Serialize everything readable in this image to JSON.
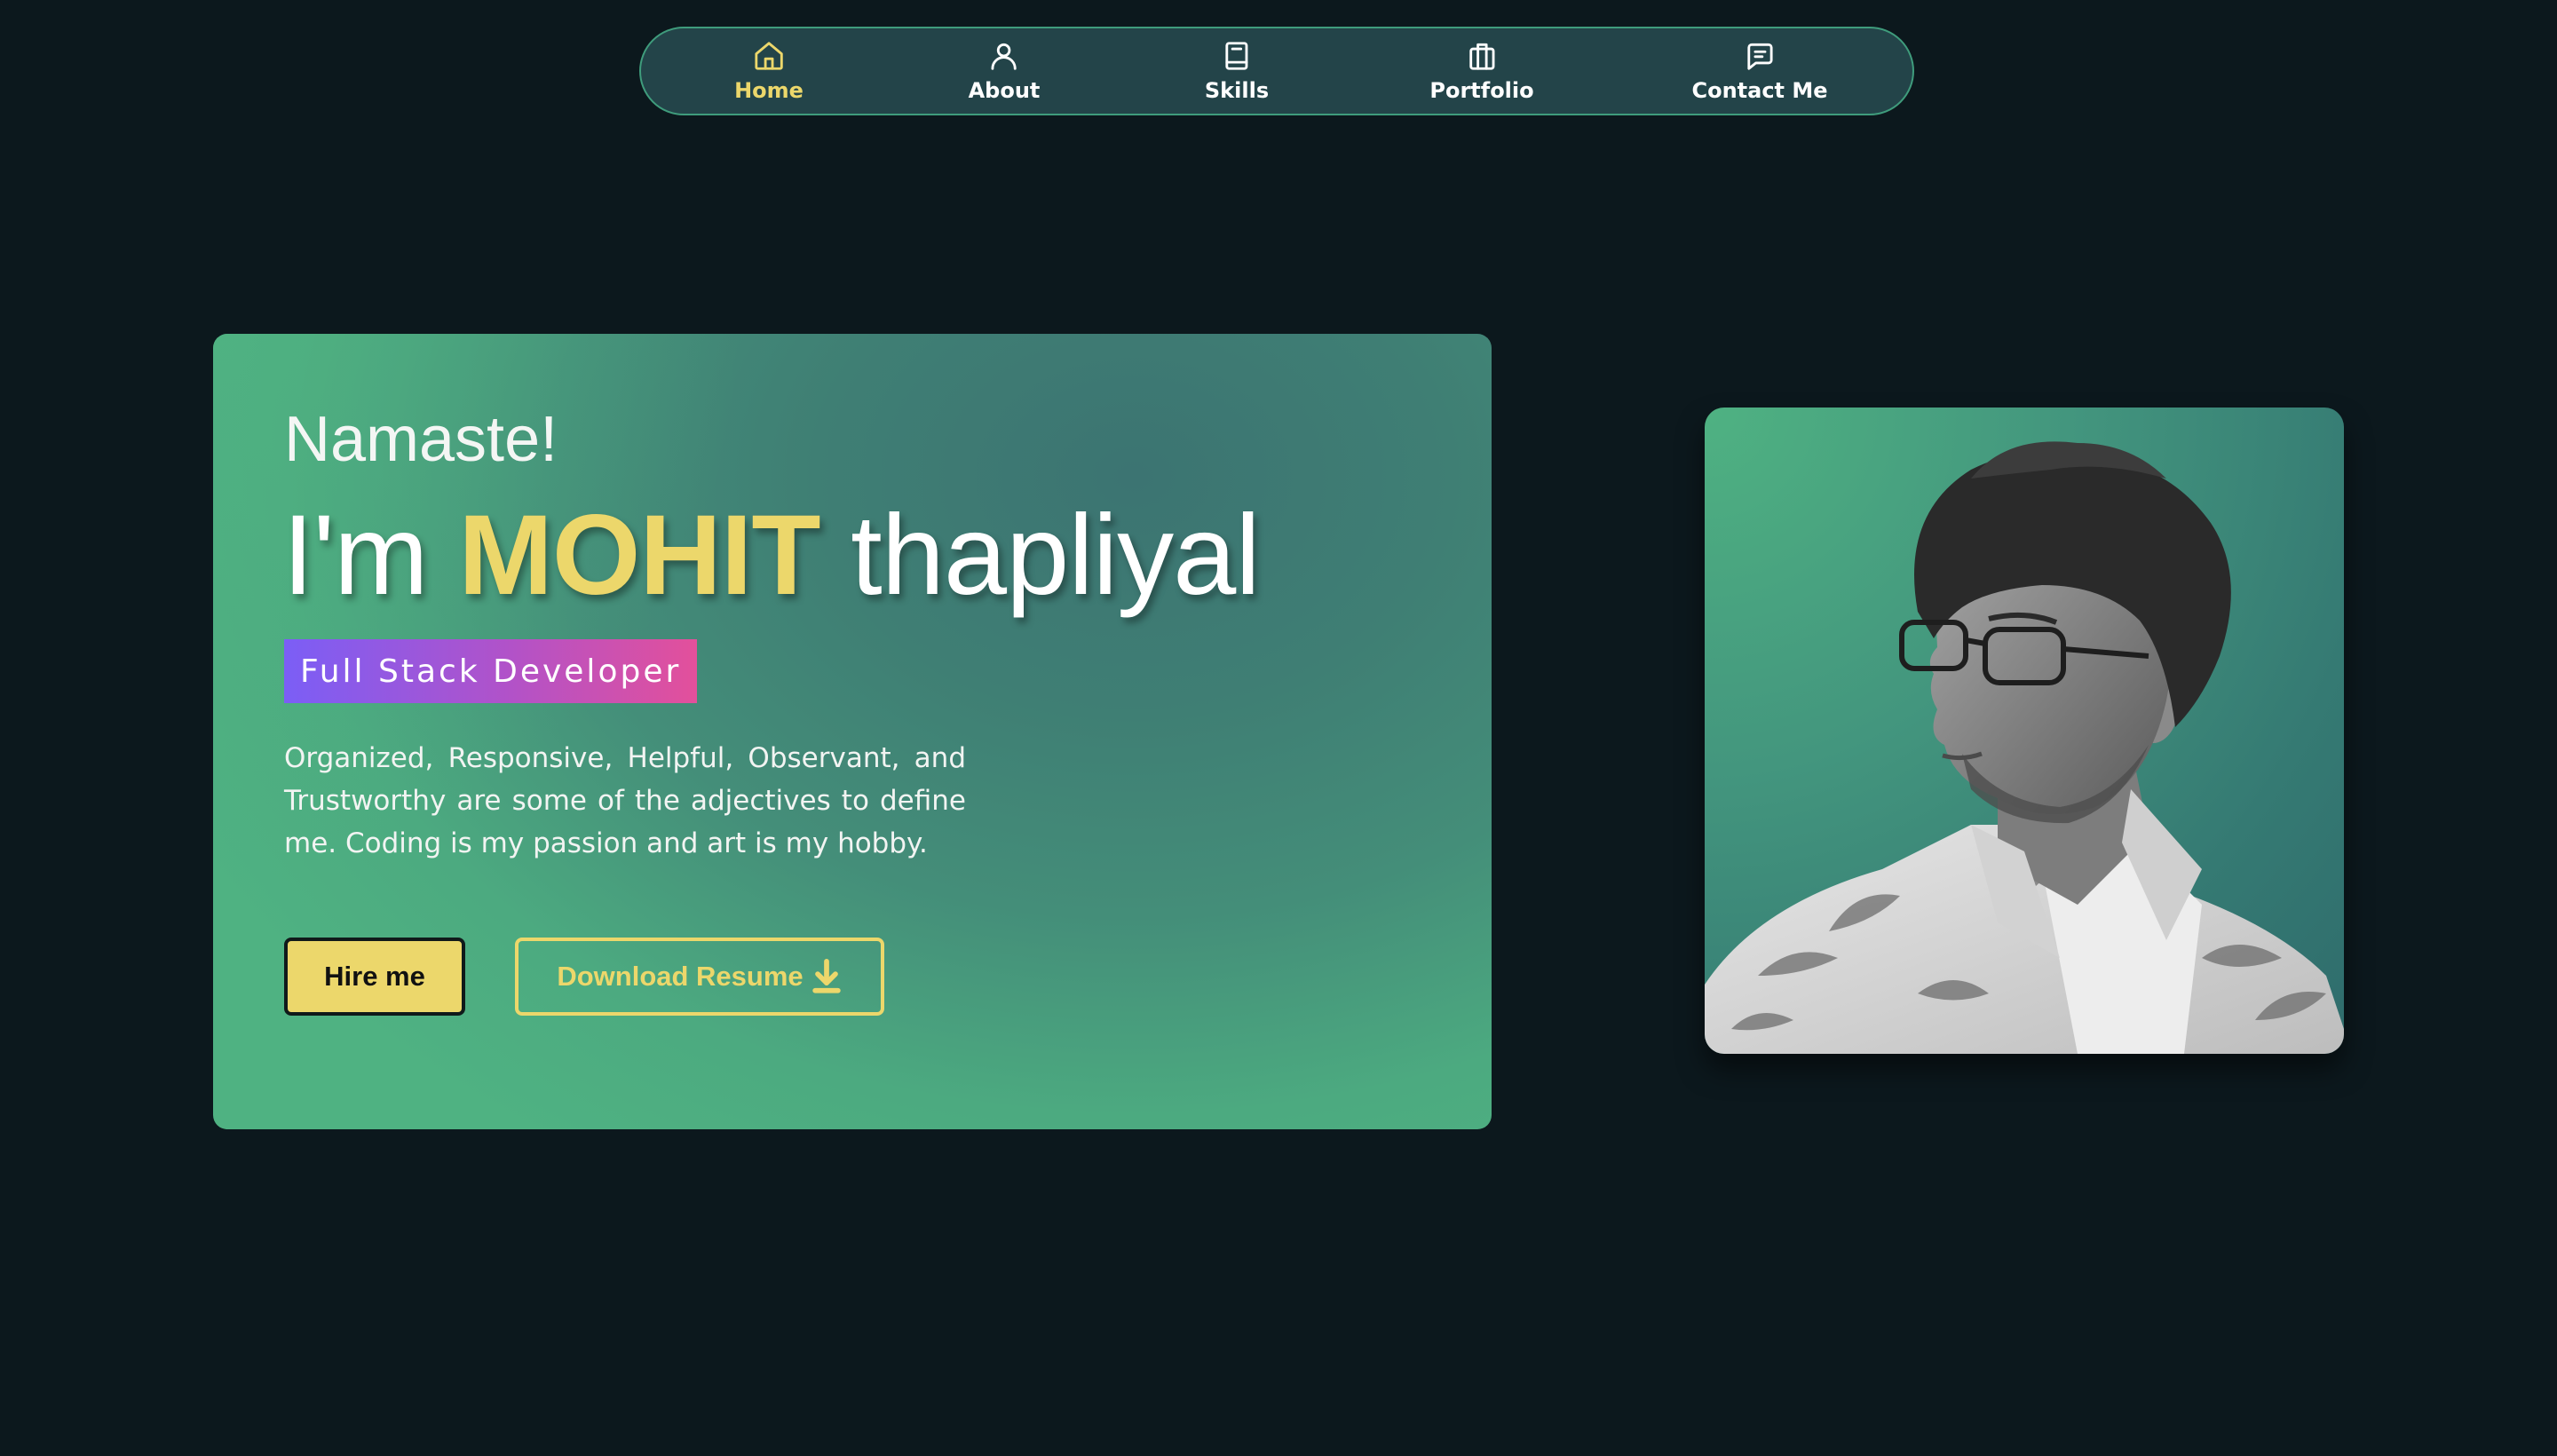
{
  "nav": {
    "items": [
      {
        "label": "Home",
        "icon": "home-icon",
        "active": true
      },
      {
        "label": "About",
        "icon": "user-icon",
        "active": false
      },
      {
        "label": "Skills",
        "icon": "book-icon",
        "active": false
      },
      {
        "label": "Portfolio",
        "icon": "briefcase-icon",
        "active": false
      },
      {
        "label": "Contact Me",
        "icon": "message-icon",
        "active": false
      }
    ]
  },
  "hero": {
    "greeting": "Namaste!",
    "headline_prefix": "I'm",
    "name_first": "MOHIT",
    "name_last": "thapliyal",
    "role": "Full Stack Developer",
    "bio": "Organized, Responsive, Helpful, Observant, and Trustworthy are some of the adjectives to define me. Coding is my passion and art is my hobby.",
    "hire_label": "Hire me",
    "download_label": "Download Resume"
  },
  "colors": {
    "background": "#0c181d",
    "nav_bg": "#234449",
    "accent_yellow": "#ecd76b",
    "card_green": "#4fb282",
    "badge_gradient_start": "#7b5ef6",
    "badge_gradient_end": "#e3509b"
  }
}
